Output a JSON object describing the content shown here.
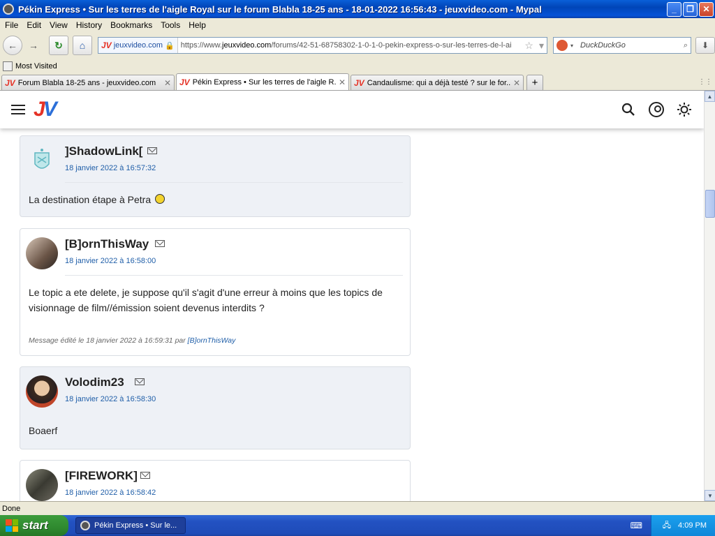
{
  "window": {
    "title": "Pékin Express • Sur les terres de l'aigle Royal sur le forum Blabla 18-25 ans - 18-01-2022 16:56:43 - jeuxvideo.com - Mypal",
    "minimize": "_",
    "maximize": "❐",
    "close": "✕"
  },
  "menu": [
    "File",
    "Edit",
    "View",
    "History",
    "Bookmarks",
    "Tools",
    "Help"
  ],
  "nav": {
    "site_identity": "jeuxvideo.com",
    "url_prefix": "https://www.",
    "url_domain": "jeuxvideo.com",
    "url_path": "/forums/42-51-68758302-1-0-1-0-pekin-express-o-sur-les-terres-de-l-ai",
    "search_placeholder": "DuckDuckGo"
  },
  "bookmarks": {
    "most_visited": "Most Visited"
  },
  "tabs": [
    {
      "label": "Forum Blabla 18-25 ans - jeuxvideo.com",
      "active": false
    },
    {
      "label": "Pékin Express • Sur les terres de l'aigle R...",
      "active": true
    },
    {
      "label": "Candaulisme: qui a déjà testé ? sur le for...",
      "active": false
    }
  ],
  "posts": [
    {
      "author": "]ShadowLink[",
      "date": "18 janvier 2022 à 16:57:32",
      "message": "La destination étape à Petra",
      "edited": ""
    },
    {
      "author": "[B]ornThisWay",
      "date": "18 janvier 2022 à 16:58:00",
      "message": "Le topic a ete delete, je suppose qu'il s'agit d'une erreur à moins que les topics de visionnage de film//émission soient devenus interdits ?",
      "edited_prefix": "Message édité le 18 janvier 2022 à 16:59:31 par",
      "edited_user": "[B]ornThisWay"
    },
    {
      "author": "Volodim23",
      "date": "18 janvier 2022 à 16:58:30",
      "message": "Boaerf"
    },
    {
      "author": "[FIREWORK]",
      "date": "18 janvier 2022 à 16:58:42",
      "message": ""
    }
  ],
  "status": "Done",
  "taskbar": {
    "start": "start",
    "task": "Pékin Express • Sur le...",
    "clock": "4:09 PM"
  }
}
